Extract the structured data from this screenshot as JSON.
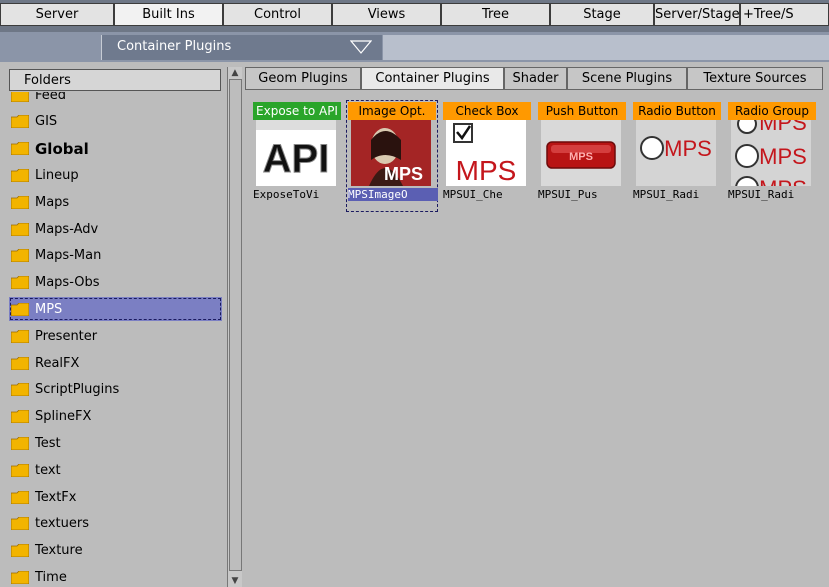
{
  "top_tabs": [
    {
      "label": "Server",
      "active": false
    },
    {
      "label": "Built Ins",
      "active": true
    },
    {
      "label": "Control",
      "active": false
    },
    {
      "label": "Views",
      "active": false
    },
    {
      "label": "Tree",
      "active": false
    },
    {
      "label": "Stage",
      "active": false
    },
    {
      "label": "Server/Stage",
      "active": false
    },
    {
      "label": "+Tree/S",
      "active": false
    }
  ],
  "dropdown": {
    "value": "Container Plugins"
  },
  "folders": {
    "header": "Folders",
    "items": [
      {
        "label": "Feed"
      },
      {
        "label": "GIS"
      },
      {
        "label": "Global"
      },
      {
        "label": "Lineup"
      },
      {
        "label": "Maps"
      },
      {
        "label": "Maps-Adv"
      },
      {
        "label": "Maps-Man"
      },
      {
        "label": "Maps-Obs"
      },
      {
        "label": "MPS"
      },
      {
        "label": "Presenter"
      },
      {
        "label": "RealFX"
      },
      {
        "label": "ScriptPlugins"
      },
      {
        "label": "SplineFX"
      },
      {
        "label": "Test"
      },
      {
        "label": "text"
      },
      {
        "label": "TextFx"
      },
      {
        "label": "textuers"
      },
      {
        "label": "Texture"
      },
      {
        "label": "Time"
      }
    ],
    "selected": "MPS",
    "bold": "Global"
  },
  "plugin_tabs": [
    {
      "label": "Geom Plugins",
      "active": false
    },
    {
      "label": "Container Plugins",
      "active": true
    },
    {
      "label": "Shader",
      "active": false
    },
    {
      "label": "Scene Plugins",
      "active": false
    },
    {
      "label": "Texture Sources",
      "active": false
    }
  ],
  "plugins": [
    {
      "title": "Expose to API",
      "thumb_text": "API",
      "name": "ExposeToVi",
      "title_bg": "#2aa52a",
      "title_color": "#ffffff"
    },
    {
      "title": "Image Opt.",
      "thumb_text": "MPS",
      "name": "MPSImageO",
      "title_bg": "#ff9900",
      "title_color": "#000000",
      "selected": true
    },
    {
      "title": "Check Box",
      "thumb_text": "MPS",
      "name": "MPSUI_Che",
      "title_bg": "#ff9900",
      "title_color": "#000000"
    },
    {
      "title": "Push Button",
      "thumb_text": "MPS",
      "name": "MPSUI_Pus",
      "title_bg": "#ff9900",
      "title_color": "#000000"
    },
    {
      "title": "Radio Button",
      "thumb_text": "MPS",
      "name": "MPSUI_Radi",
      "title_bg": "#ff9900",
      "title_color": "#000000"
    },
    {
      "title": "Radio Group",
      "thumb_text": "MPS",
      "name": "MPSUI_Radi",
      "title_bg": "#ff9900",
      "title_color": "#000000"
    }
  ],
  "colors": {
    "accent_select": "#7b7fc3",
    "mps_red": "#c4161c",
    "folder_yellow": "#f2b400"
  }
}
